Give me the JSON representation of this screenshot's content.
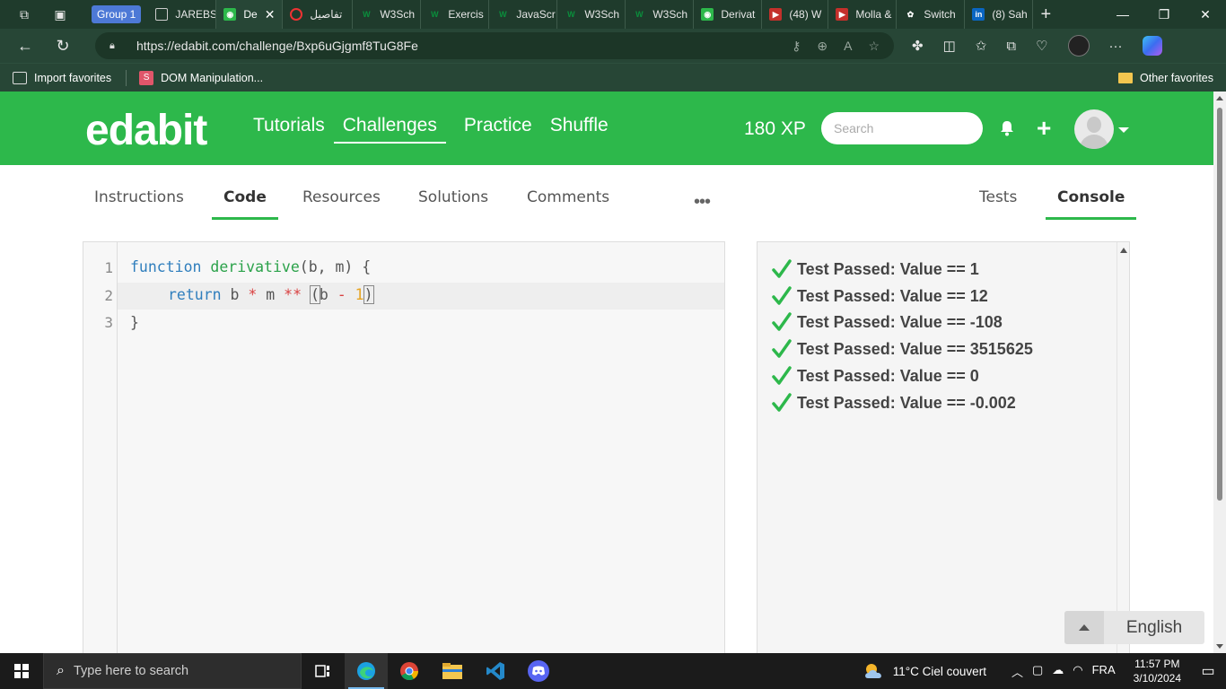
{
  "browser": {
    "tab_group": "Group 1",
    "tabs": [
      {
        "label": "JAREBS",
        "favicon": "page-icon"
      },
      {
        "label": "De",
        "favicon": "edabit-icon",
        "active": true
      },
      {
        "label": "تفاصيل",
        "favicon": "opera-icon"
      },
      {
        "label": "W3Sch",
        "favicon": "w3schools-icon"
      },
      {
        "label": "Exercis",
        "favicon": "w3schools-icon"
      },
      {
        "label": "JavaScr",
        "favicon": "w3schools-icon"
      },
      {
        "label": "W3Sch",
        "favicon": "w3schools-icon"
      },
      {
        "label": "W3Sch",
        "favicon": "w3schools-icon"
      },
      {
        "label": "Derivat",
        "favicon": "edabit-icon"
      },
      {
        "label": "(48) W",
        "favicon": "youtube-icon"
      },
      {
        "label": "Molla &",
        "favicon": "youtube-icon"
      },
      {
        "label": "Switch",
        "favicon": "chatgpt-icon"
      },
      {
        "label": "(8) Sah",
        "favicon": "linkedin-icon"
      }
    ],
    "url": "https://edabit.com/challenge/Bxp6uGjgmf8TuG8Fe",
    "favorites": {
      "import": "Import favorites",
      "dom": "DOM Manipulation...",
      "other": "Other favorites"
    }
  },
  "site": {
    "logo": "edabit",
    "nav": [
      "Tutorials",
      "Challenges",
      "Practice",
      "Shuffle"
    ],
    "active_nav": "Challenges",
    "xp": "180 XP",
    "search_placeholder": "Search"
  },
  "tabs": {
    "instructions": "Instructions",
    "code": "Code",
    "resources": "Resources",
    "solutions": "Solutions",
    "comments": "Comments",
    "more": "•••",
    "tests": "Tests",
    "console": "Console"
  },
  "editor": {
    "line_numbers": [
      "1",
      "2",
      "3"
    ],
    "line1": {
      "kw": "function",
      "fn": "derivative",
      "rest": "(b, m) {"
    },
    "line2": {
      "kw": "return",
      "b": " b ",
      "op1": "*",
      "m": " m ",
      "op2": "**",
      "sp": " ",
      "open": "(",
      "b2": "b",
      "minus": " - ",
      "one": "1",
      "close": ")"
    },
    "line3": "}"
  },
  "console": {
    "results": [
      "Test Passed: Value == 1",
      "Test Passed: Value == 12",
      "Test Passed: Value == -108",
      "Test Passed: Value == 3515625",
      "Test Passed: Value == 0",
      "Test Passed: Value == -0.002"
    ]
  },
  "language": "English",
  "taskbar": {
    "search_placeholder": "Type here to search",
    "weather": "11°C  Ciel couvert",
    "lang": "FRA",
    "time": "11:57 PM",
    "date": "3/10/2024"
  },
  "colors": {
    "brand_green": "#2db84b",
    "check_green": "#2db84b"
  }
}
